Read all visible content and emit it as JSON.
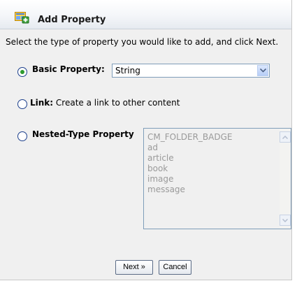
{
  "dialog": {
    "title": "Add Property",
    "instructions": "Select the type of property you would like to add, and click Next."
  },
  "options": {
    "basic": {
      "label": "Basic Property:",
      "selected": true
    },
    "link": {
      "label": "Link:",
      "description": "Create a link to other content",
      "selected": false
    },
    "nested": {
      "label": "Nested-Type Property",
      "selected": false
    }
  },
  "basic_type_select": {
    "value": "String"
  },
  "nested_type_list": {
    "items": [
      "CM_FOLDER_BADGE",
      "ad",
      "article",
      "book",
      "image",
      "message"
    ],
    "enabled": false
  },
  "buttons": {
    "next": "Next »",
    "cancel": "Cancel"
  },
  "icons": {
    "header": "add-property-icon",
    "select": "chevron-down-icon",
    "scroll_up": "scroll-up-arrow-icon",
    "scroll_down": "scroll-down-arrow-icon"
  },
  "colors": {
    "radio_selected": "#2e9b2e",
    "border": "#7f9db9"
  }
}
